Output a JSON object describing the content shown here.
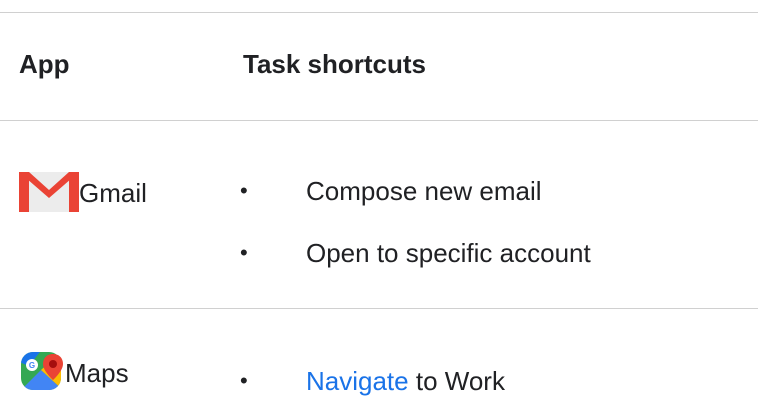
{
  "table": {
    "headers": {
      "app": "App",
      "task_shortcuts": "Task shortcuts"
    },
    "rows": [
      {
        "app": {
          "name": "Gmail",
          "icon": "gmail-icon"
        },
        "shortcuts": [
          {
            "text": "Compose new email"
          },
          {
            "text": "Open to specific account"
          }
        ]
      },
      {
        "app": {
          "name": "Maps",
          "icon": "maps-icon"
        },
        "shortcuts": [
          {
            "link_text": "Navigate",
            "text": " to Work"
          }
        ]
      }
    ]
  },
  "colors": {
    "link": "#1a73e8",
    "divider": "#d0d0d0",
    "gmail_red": "#ea4335"
  }
}
